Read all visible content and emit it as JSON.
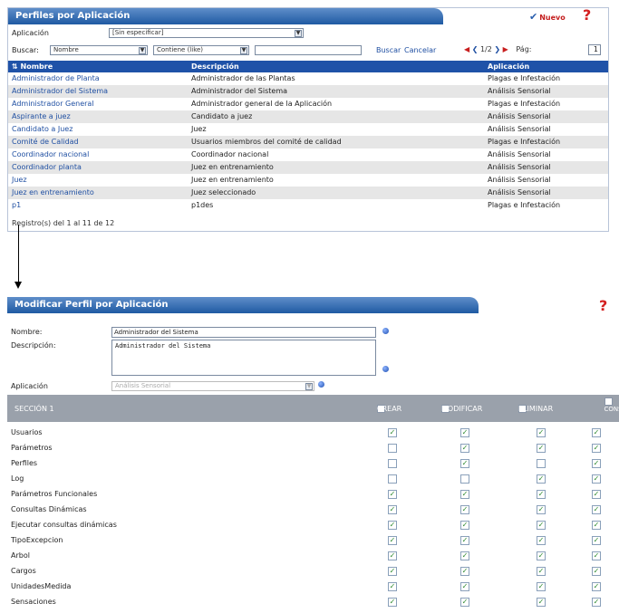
{
  "list": {
    "title": "Perfiles por Aplicación",
    "new_label": "Nuevo",
    "help_icon": "?",
    "app_label": "Aplicación",
    "app_value": "[Sin especificar]",
    "search_label": "Buscar:",
    "search_field_value": "Nombre",
    "search_op_value": "Contiene (like)",
    "search_btn": "Buscar",
    "cancel_btn": "Cancelar",
    "page_info": "1/2",
    "page_label": "Pág:",
    "page_num": "1",
    "columns": [
      "Nombre",
      "Descripción",
      "Aplicación"
    ],
    "rows": [
      {
        "name": "Administrador de Planta",
        "desc": "Administrador de las Plantas",
        "app": "Plagas e Infestación"
      },
      {
        "name": "Administrador del Sistema",
        "desc": "Administrador del Sistema",
        "app": "Análisis Sensorial"
      },
      {
        "name": "Administrador General",
        "desc": "Administrador general de la Aplicación",
        "app": "Plagas e Infestación"
      },
      {
        "name": "Aspirante a juez",
        "desc": "Candidato a juez",
        "app": "Análisis Sensorial"
      },
      {
        "name": "Candidato a Juez",
        "desc": "Juez",
        "app": "Análisis Sensorial"
      },
      {
        "name": "Comité de Calidad",
        "desc": "Usuarios miembros del comité de calidad",
        "app": "Plagas e Infestación"
      },
      {
        "name": "Coordinador nacional",
        "desc": "Coordinador nacional",
        "app": "Análisis Sensorial"
      },
      {
        "name": "Coordinador planta",
        "desc": "Juez en entrenamiento",
        "app": "Análisis Sensorial"
      },
      {
        "name": "Juez",
        "desc": "Juez en entrenamiento",
        "app": "Análisis Sensorial"
      },
      {
        "name": "Juez en entrenamiento",
        "desc": "Juez seleccionado",
        "app": "Análisis Sensorial"
      },
      {
        "name": "p1",
        "desc": "p1des",
        "app": "Plagas e Infestación"
      }
    ],
    "footer": "Registro(s) del 1 al 11 de 12"
  },
  "edit": {
    "title": "Modificar Perfil por Aplicación",
    "help_icon": "?",
    "name_label": "Nombre:",
    "name_value": "Administrador del Sistema",
    "desc_label": "Descripción:",
    "desc_value": "Administrador del Sistema",
    "app_label": "Aplicación",
    "app_value": "Análisis Sensorial",
    "section_label": "SECCIÓN 1",
    "perm_cols": [
      "CREAR",
      "MODIFICAR",
      "ELIMINAR",
      "CONSULTA"
    ],
    "perms": [
      {
        "label": "Usuarios",
        "v": [
          true,
          true,
          true,
          true
        ]
      },
      {
        "label": "Parámetros",
        "v": [
          false,
          true,
          true,
          true
        ]
      },
      {
        "label": "Perfiles",
        "v": [
          false,
          true,
          false,
          true
        ]
      },
      {
        "label": "Log",
        "v": [
          false,
          false,
          true,
          true
        ]
      },
      {
        "label": "Parámetros Funcionales",
        "v": [
          true,
          true,
          true,
          true
        ]
      },
      {
        "label": "Consultas Dinámicas",
        "v": [
          true,
          true,
          true,
          true
        ]
      },
      {
        "label": "Ejecutar consultas dinámicas",
        "v": [
          true,
          true,
          true,
          true
        ]
      },
      {
        "label": "TipoExcepcion",
        "v": [
          true,
          true,
          true,
          true
        ]
      },
      {
        "label": "Arbol",
        "v": [
          true,
          true,
          true,
          true
        ]
      },
      {
        "label": "Cargos",
        "v": [
          true,
          true,
          true,
          true
        ]
      },
      {
        "label": "UnidadesMedida",
        "v": [
          true,
          true,
          true,
          true
        ]
      },
      {
        "label": "Sensaciones",
        "v": [
          true,
          true,
          true,
          true
        ]
      }
    ]
  },
  "icons": {
    "new": "new-record-icon",
    "help": "help-icon",
    "prev": "prev-page-icon",
    "next": "next-page-icon",
    "first": "first-page-icon",
    "last": "last-page-icon"
  }
}
